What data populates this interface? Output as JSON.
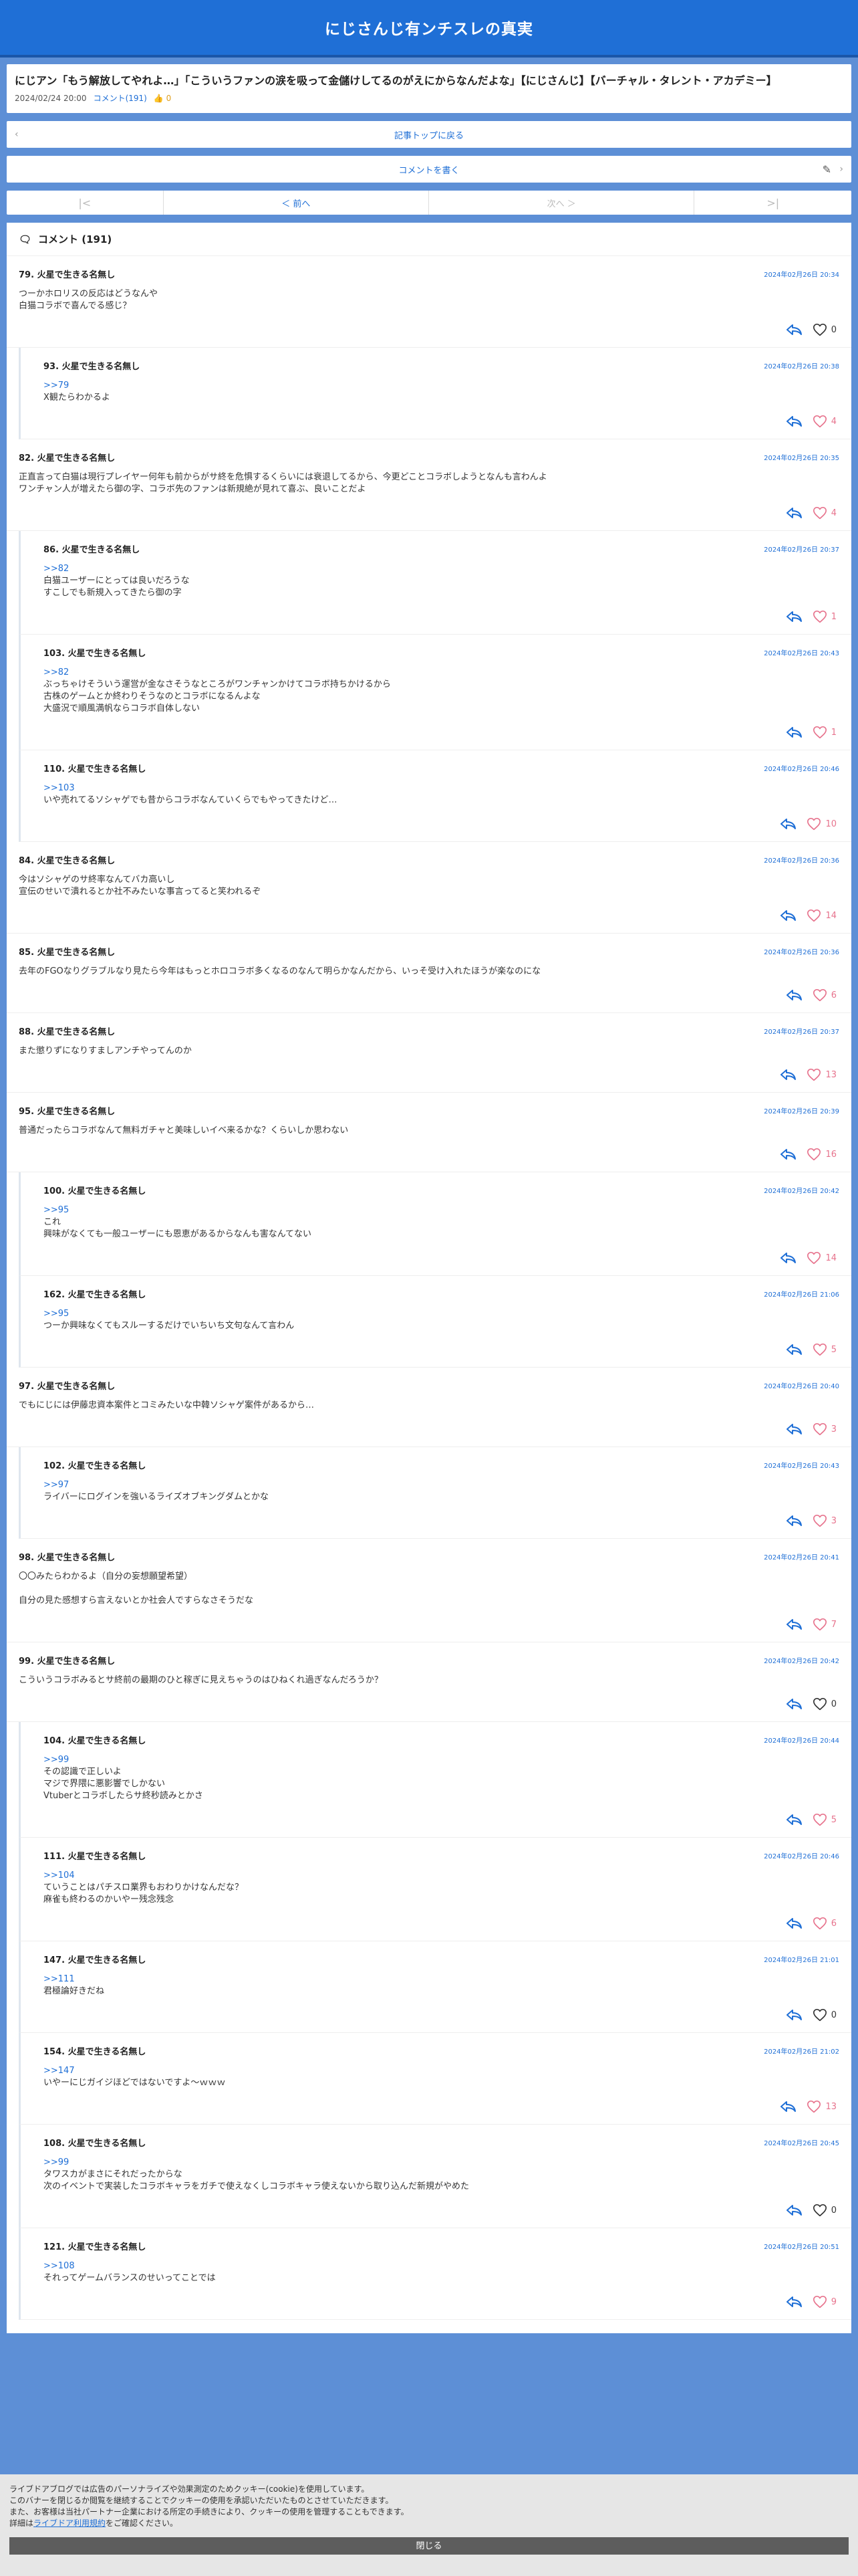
{
  "site": {
    "title": "にじさんじ有ンチスレの真実"
  },
  "article": {
    "title": "にじアン「もう解放してやれよ…」「こういうファンの涙を吸って金儲けしてるのがえにからなんだよな」【にじさんじ】【バーチャル・タレント・アカデミー】",
    "date": "2024/02/24 20:00",
    "comment_link": "コメント(191)",
    "like_count": "0"
  },
  "nav": {
    "back_label": "記事トップに戻る",
    "write_label": "コメントを書く"
  },
  "pager": {
    "first": "|<",
    "prev": "＜ 前へ",
    "next": "次へ ＞",
    "last": ">|"
  },
  "comments_header": "コメント (191)",
  "comments": [
    {
      "no": "79.",
      "name": "火星で生きる名無し",
      "date": "2024年02月26日 20:34",
      "anchor": "",
      "text": "つーかホロリスの反応はどうなんや\n白猫コラボで喜んでる感じ？",
      "likes": "0",
      "reply": false
    },
    {
      "no": "93.",
      "name": "火星で生きる名無し",
      "date": "2024年02月26日 20:38",
      "anchor": ">>79",
      "text": "X観たらわかるよ",
      "likes": "4",
      "reply": true
    },
    {
      "no": "82.",
      "name": "火星で生きる名無し",
      "date": "2024年02月26日 20:35",
      "anchor": "",
      "text": "正直言って白猫は現行プレイヤー何年も前からがサ終を危惧するくらいには衰退してるから、今更どことコラボしようとなんも言わんよ\nワンチャン人が増えたら御の字、コラボ先のファンは新規絶が見れて喜ぶ、良いことだよ",
      "likes": "4",
      "reply": false
    },
    {
      "no": "86.",
      "name": "火星で生きる名無し",
      "date": "2024年02月26日 20:37",
      "anchor": ">>82",
      "text": "白猫ユーザーにとっては良いだろうな\nすこしでも新規入ってきたら御の字",
      "likes": "1",
      "reply": true
    },
    {
      "no": "103.",
      "name": "火星で生きる名無し",
      "date": "2024年02月26日 20:43",
      "anchor": ">>82",
      "text": "ぶっちゃけそういう運営が金なさそうなところがワンチャンかけてコラボ持ちかけるから\n古株のゲームとか終わりそうなのとコラボになるんよな\n大盛況で順風満帆ならコラボ自体しない",
      "likes": "1",
      "reply": true
    },
    {
      "no": "110.",
      "name": "火星で生きる名無し",
      "date": "2024年02月26日 20:46",
      "anchor": ">>103",
      "text": "いや売れてるソシャゲでも昔からコラボなんていくらでもやってきたけど…",
      "likes": "10",
      "reply": true
    },
    {
      "no": "84.",
      "name": "火星で生きる名無し",
      "date": "2024年02月26日 20:36",
      "anchor": "",
      "text": "今はソシャゲのサ終率なんてバカ高いし\n宣伝のせいで潰れるとか社不みたいな事言ってると笑われるぞ",
      "likes": "14",
      "reply": false
    },
    {
      "no": "85.",
      "name": "火星で生きる名無し",
      "date": "2024年02月26日 20:36",
      "anchor": "",
      "text": "去年のFGOなりグラブルなり見たら今年はもっとホロコラボ多くなるのなんて明らかなんだから、いっそ受け入れたほうが楽なのにな",
      "likes": "6",
      "reply": false
    },
    {
      "no": "88.",
      "name": "火星で生きる名無し",
      "date": "2024年02月26日 20:37",
      "anchor": "",
      "text": "また懲りずになりすましアンチやってんのか",
      "likes": "13",
      "reply": false
    },
    {
      "no": "95.",
      "name": "火星で生きる名無し",
      "date": "2024年02月26日 20:39",
      "anchor": "",
      "text": "普通だったらコラボなんて無料ガチャと美味しいイベ来るかな？くらいしか思わない",
      "likes": "16",
      "reply": false
    },
    {
      "no": "100.",
      "name": "火星で生きる名無し",
      "date": "2024年02月26日 20:42",
      "anchor": ">>95",
      "text": "これ\n興味がなくても一般ユーザーにも恩恵があるからなんも害なんてない",
      "likes": "14",
      "reply": true
    },
    {
      "no": "162.",
      "name": "火星で生きる名無し",
      "date": "2024年02月26日 21:06",
      "anchor": ">>95",
      "text": "つーか興味なくてもスルーするだけでいちいち文句なんて言わん",
      "likes": "5",
      "reply": true
    },
    {
      "no": "97.",
      "name": "火星で生きる名無し",
      "date": "2024年02月26日 20:40",
      "anchor": "",
      "text": "でもにじには伊藤忠資本案件とコミみたいな中韓ソシャゲ案件があるから…",
      "likes": "3",
      "reply": false
    },
    {
      "no": "102.",
      "name": "火星で生きる名無し",
      "date": "2024年02月26日 20:43",
      "anchor": ">>97",
      "text": "ライバーにログインを強いるライズオブキングダムとかな",
      "likes": "3",
      "reply": true
    },
    {
      "no": "98.",
      "name": "火星で生きる名無し",
      "date": "2024年02月26日 20:41",
      "anchor": "",
      "text": "〇〇みたらわかるよ（自分の妄想願望希望）\n\n自分の見た感想すら言えないとか社会人ですらなさそうだな",
      "likes": "7",
      "reply": false
    },
    {
      "no": "99.",
      "name": "火星で生きる名無し",
      "date": "2024年02月26日 20:42",
      "anchor": "",
      "text": "こういうコラボみるとサ終前の最期のひと稼ぎに見えちゃうのはひねくれ過ぎなんだろうか？",
      "likes": "0",
      "reply": false
    },
    {
      "no": "104.",
      "name": "火星で生きる名無し",
      "date": "2024年02月26日 20:44",
      "anchor": ">>99",
      "text": "その認識で正しいよ\nマジで界隈に悪影響でしかない\nVtuberとコラボしたらサ終秒読みとかさ",
      "likes": "5",
      "reply": true
    },
    {
      "no": "111.",
      "name": "火星で生きる名無し",
      "date": "2024年02月26日 20:46",
      "anchor": ">>104",
      "text": "ていうことはパチスロ業界もおわりかけなんだな？\n麻雀も終わるのかいやー残念残念",
      "likes": "6",
      "reply": true
    },
    {
      "no": "147.",
      "name": "火星で生きる名無し",
      "date": "2024年02月26日 21:01",
      "anchor": ">>111",
      "text": "君極論好きだね",
      "likes": "0",
      "reply": true
    },
    {
      "no": "154.",
      "name": "火星で生きる名無し",
      "date": "2024年02月26日 21:02",
      "anchor": ">>147",
      "text": "いやーにじガイジほどではないですよ〜ｗｗｗ",
      "likes": "13",
      "reply": true
    },
    {
      "no": "108.",
      "name": "火星で生きる名無し",
      "date": "2024年02月26日 20:45",
      "anchor": ">>99",
      "text": "タワスカがまさにそれだったからな\n次のイベントで実装したコラボキャラをガチで使えなくしコラボキャラ使えないから取り込んだ新規がやめた",
      "likes": "0",
      "reply": true
    },
    {
      "no": "121.",
      "name": "火星で生きる名無し",
      "date": "2024年02月26日 20:51",
      "anchor": ">>108",
      "text": "それってゲームバランスのせいってことでは",
      "likes": "9",
      "reply": true
    }
  ],
  "cookie": {
    "line1": "ライブドアブログでは広告のパーソナライズや効果測定のためクッキー(cookie)を使用しています。",
    "line2": "このバナーを閉じるか閲覧を継続することでクッキーの使用を承認いただいたものとさせていただきます。",
    "line3": "また、お客様は当社パートナー企業における所定の手続きにより、クッキーの使用を管理することもできます。",
    "line4_prefix": "詳細は",
    "line4_link": "ライブドア利用規約",
    "line4_suffix": "をご確認ください。",
    "close_label": "閉じる"
  }
}
